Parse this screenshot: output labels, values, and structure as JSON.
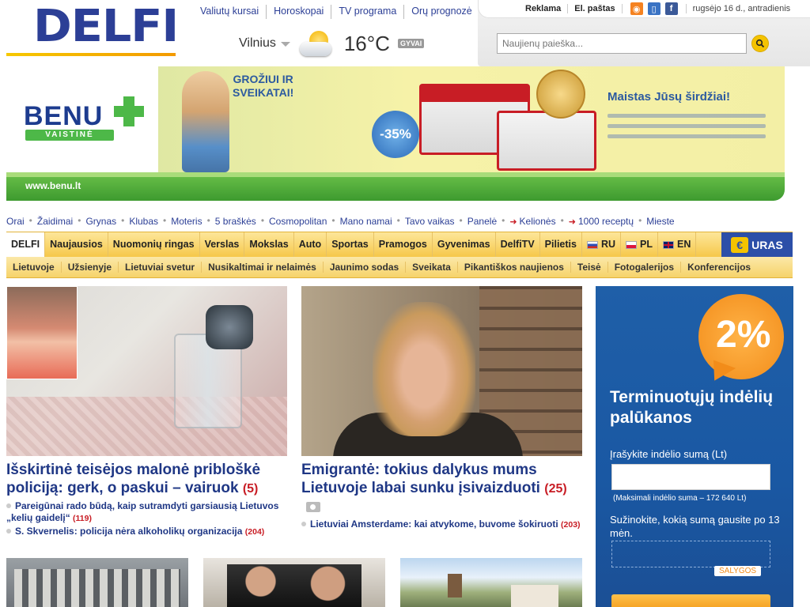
{
  "brand": {
    "logo_text": "DELFI"
  },
  "top_links": [
    "Valiutų kursai",
    "Horoskopai",
    "TV programa",
    "Orų prognozė"
  ],
  "utility": {
    "advertising": "Reklama",
    "email": "El. paštas",
    "date": "rugsėjo 16 d., antradienis",
    "icons": [
      "rss-icon",
      "mobile-icon",
      "facebook-icon"
    ]
  },
  "weather": {
    "city": "Vilnius",
    "temperature": "16°C",
    "live_badge": "GYVAI",
    "icon": "partly-cloudy-icon"
  },
  "search": {
    "placeholder": "Naujienų paieška..."
  },
  "banner": {
    "brand": "BENU",
    "brand_sub": "VAISTINĖ",
    "slogan_line1": "GROŽIUI IR",
    "slogan_line2": "SVEIKATAI!",
    "discount": "-35%",
    "tagline": "Maistas Jūsų širdžiai!",
    "url": "www.benu.lt",
    "colors": {
      "brand_blue": "#1d3c8f",
      "brand_green": "#4db848"
    }
  },
  "section_links": [
    {
      "label": "Orai",
      "arrow": false
    },
    {
      "label": "Žaidimai",
      "arrow": false
    },
    {
      "label": "Grynas",
      "arrow": false
    },
    {
      "label": "Klubas",
      "arrow": false
    },
    {
      "label": "Moteris",
      "arrow": false
    },
    {
      "label": "5 braškės",
      "arrow": false
    },
    {
      "label": "Cosmopolitan",
      "arrow": false
    },
    {
      "label": "Mano namai",
      "arrow": false
    },
    {
      "label": "Tavo vaikas",
      "arrow": false
    },
    {
      "label": "Panelė",
      "arrow": false
    },
    {
      "label": "Kelionės",
      "arrow": true
    },
    {
      "label": "1000 receptų",
      "arrow": true
    },
    {
      "label": "Mieste",
      "arrow": false
    }
  ],
  "main_nav": {
    "tabs": [
      "DELFI",
      "Naujausios",
      "Nuomonių ringas",
      "Verslas",
      "Mokslas",
      "Auto",
      "Sportas",
      "Pramogos",
      "Gyvenimas",
      "DelfiTV",
      "Pilietis"
    ],
    "languages": [
      {
        "code": "RU",
        "flag": "ru-flag-icon"
      },
      {
        "code": "PL",
        "flag": "pl-flag-icon"
      },
      {
        "code": "EN",
        "flag": "uk-flag-icon"
      }
    ],
    "euras": {
      "symbol": "€",
      "label": "URAS"
    },
    "active_color": "#ffffff",
    "bar_color": "#f6c84a"
  },
  "sub_nav": [
    "Lietuvoje",
    "Užsienyje",
    "Lietuviai svetur",
    "Nusikaltimai ir nelaimės",
    "Jaunimo sodas",
    "Sveikata",
    "Pikantiškos naujienos",
    "Teisė",
    "Fotogalerijos",
    "Konferencijos"
  ],
  "stories": [
    {
      "title": "Išskirtinė teisėjos malonė pribloškė policiją: gerk, o paskui – vairuok",
      "comments": "(5)",
      "related": [
        {
          "text": "Pareigūnai rado būdą, kaip sutramdyti garsiausią Lietuvos „kelių gaidelį“",
          "comments": "(119)"
        },
        {
          "text": "S. Skvernelis: policija nėra alkoholikų organizacija",
          "comments": "(204)"
        }
      ]
    },
    {
      "title": "Emigrantė: tokius dalykus mums Lietuvoje labai sunku įsivaizduoti",
      "comments": "(25)",
      "has_gallery_icon": true,
      "related": [
        {
          "text": "Lietuviai Amsterdame: kai atvykome, buvome šokiruoti",
          "comments": "(203)"
        }
      ]
    }
  ],
  "side_ad": {
    "percent": "2%",
    "headline": "Terminuotųjų indėlių palūkanos",
    "input_label": "Įrašykite indėlio sumą (Lt)",
    "max_note": "(Maksimali indėlio suma – 172 640 Lt)",
    "result_label": "Sužinokite, kokią sumą gausite po 13 mėn.",
    "terms": "SALYGOS"
  }
}
